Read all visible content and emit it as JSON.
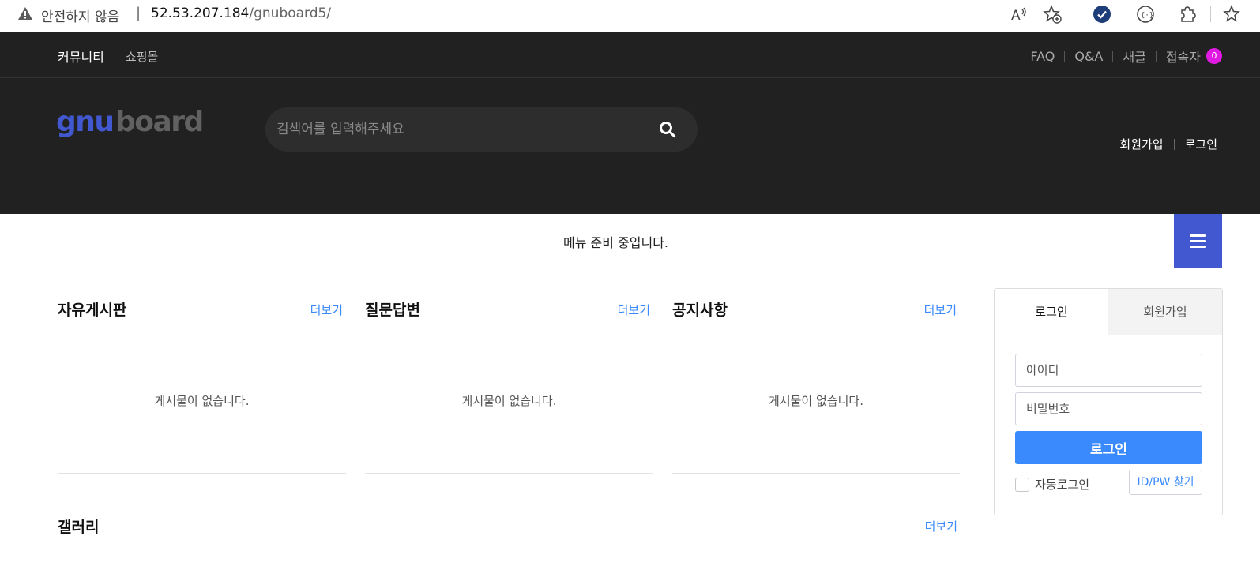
{
  "browser": {
    "security_text": "안전하지 않음",
    "separator": "|",
    "url_host": "52.53.207.184",
    "url_path": "/gnuboard5/",
    "icons": [
      "warning-icon",
      "read-aloud-icon",
      "add-favorite-icon",
      "check-circle-icon",
      "extension-icon",
      "puzzle-icon",
      "favorites-icon"
    ]
  },
  "top_bar": {
    "left_links": [
      "커뮤니티",
      "쇼핑몰"
    ],
    "right_links": [
      "FAQ",
      "Q&A",
      "새글",
      "접속자"
    ],
    "visitor_count": "0",
    "badge_color": "#e01ae2"
  },
  "header": {
    "logo_text_part1": "gnu",
    "logo_text_part2": "board",
    "logo_color1": "#4158d0",
    "logo_color2": "#616161",
    "search_placeholder": "검색어를 입력해주세요",
    "links": [
      "회원가입",
      "로그인"
    ]
  },
  "gnb": {
    "empty_message": "메뉴 준비 중입니다.",
    "menu_button_color": "#4158d0"
  },
  "boards": [
    {
      "title": "자유게시판",
      "more": "더보기",
      "empty": "게시물이 없습니다."
    },
    {
      "title": "질문답변",
      "more": "더보기",
      "empty": "게시물이 없습니다."
    },
    {
      "title": "공지사항",
      "more": "더보기",
      "empty": "게시물이 없습니다."
    }
  ],
  "gallery": {
    "title": "갤러리",
    "more": "더보기"
  },
  "login": {
    "tab_login": "로그인",
    "tab_join": "회원가입",
    "id_placeholder": "아이디",
    "pw_placeholder": "비밀번호",
    "submit": "로그인",
    "auto_login": "자동로그인",
    "find": "ID/PW 찾기",
    "accent_color": "#3a8afd"
  }
}
